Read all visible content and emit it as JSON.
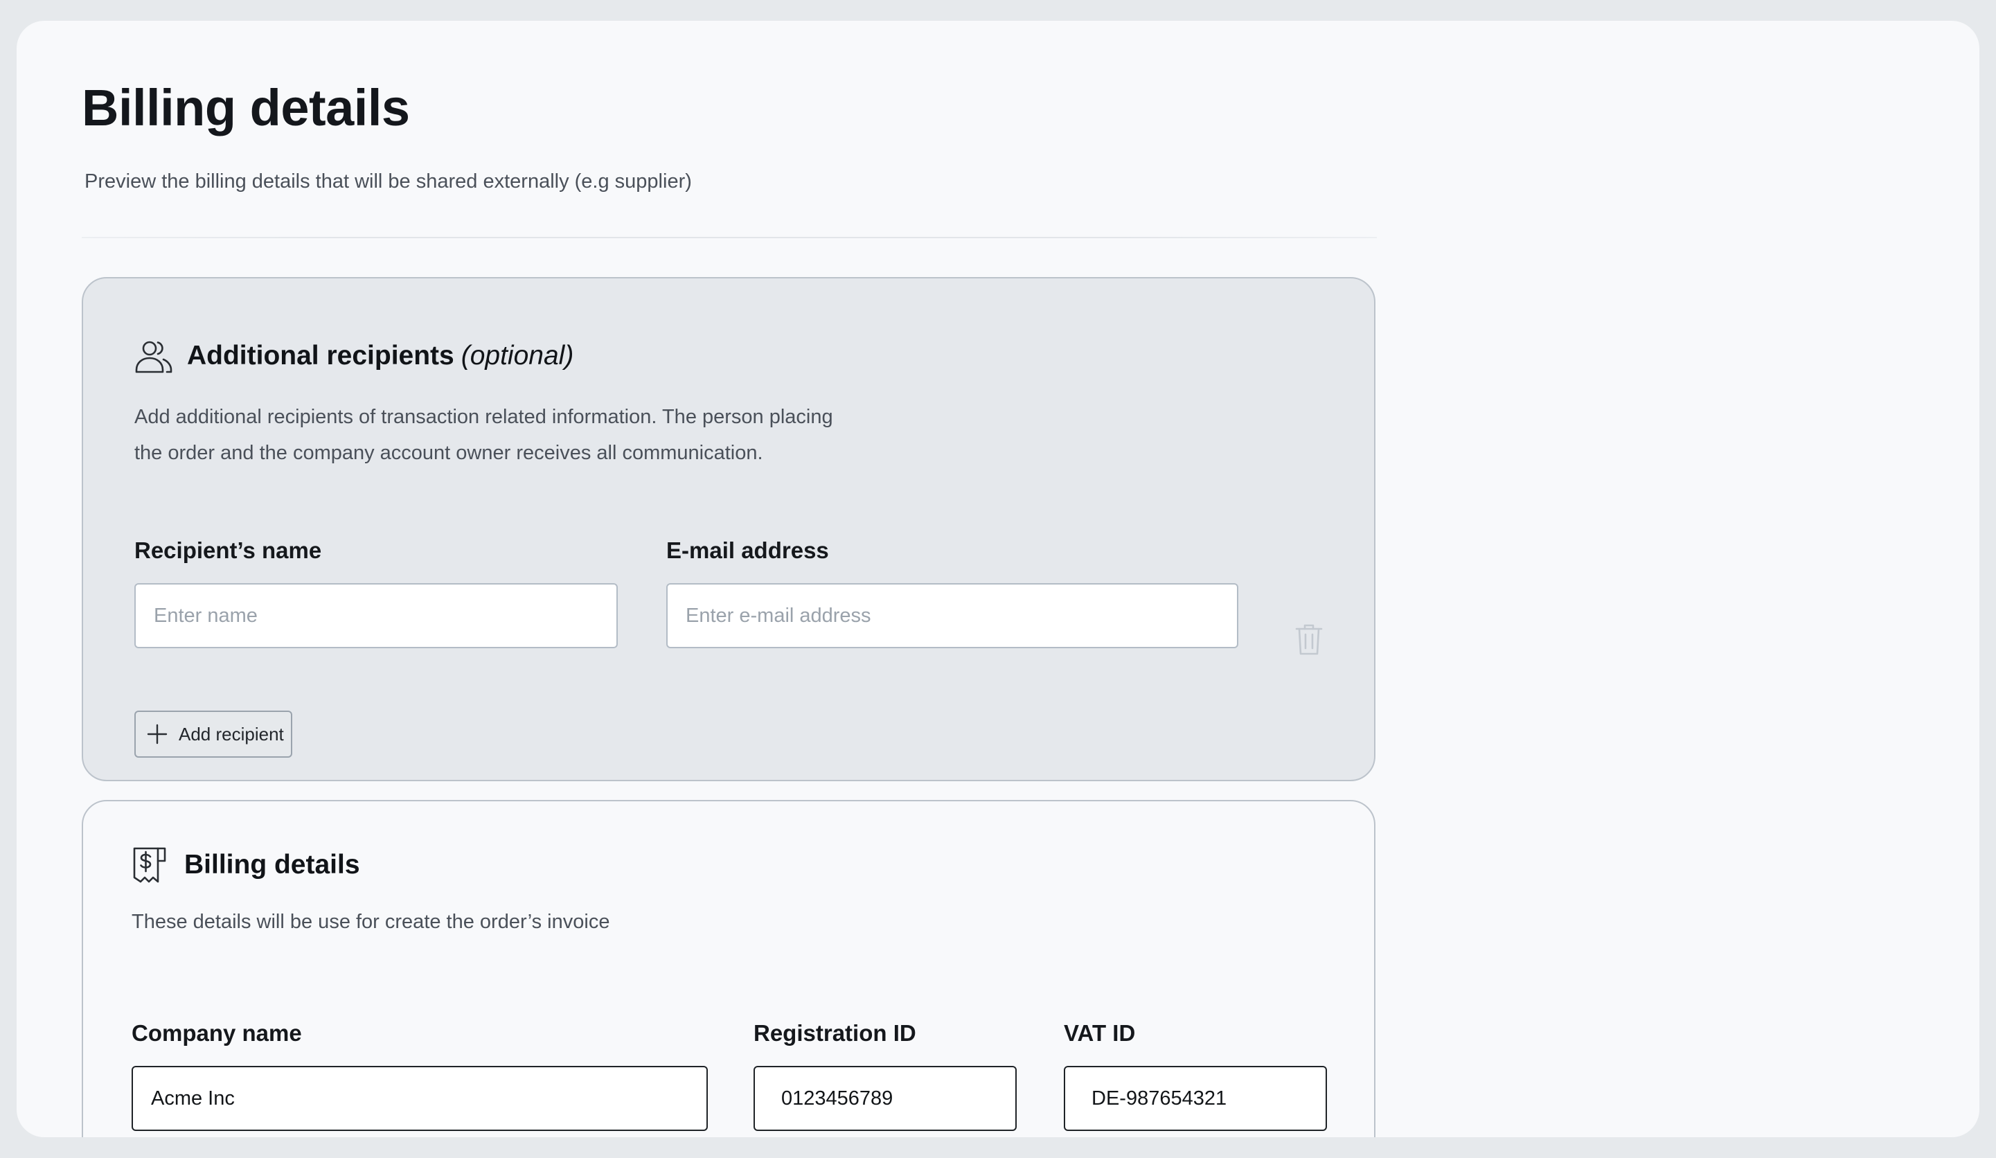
{
  "page": {
    "title": "Billing details",
    "subtitle": "Preview the billing details that will be shared externally (e.g supplier)"
  },
  "recipients": {
    "icon": "users-icon",
    "title": "Additional recipients",
    "title_optional": "(optional)",
    "description_line1": "Add additional recipients of transaction related information. The person placing",
    "description_line2": "the order and the company account owner receives all communication.",
    "name_label": "Recipient’s name",
    "name_placeholder": "Enter name",
    "name_value": "",
    "email_label": "E-mail address",
    "email_placeholder": "Enter e-mail address",
    "email_value": "",
    "delete_icon": "trash-icon",
    "add_button_label": "Add recipient",
    "add_button_icon": "plus-icon"
  },
  "billing": {
    "icon": "receipt-dollar-icon",
    "title": "Billing details",
    "description": "These details will be use for create the order’s invoice",
    "company_label": "Company name",
    "company_value": "Acme Inc",
    "registration_label": "Registration ID",
    "registration_value": "0123456789",
    "vat_label": "VAT ID",
    "vat_value": "DE-987654321"
  },
  "colors": {
    "page_bg": "#e6e9ec",
    "panel_bg": "#f8f9fb",
    "recipients_card_bg": "#e5e8ec",
    "card_border": "#bcc3cb",
    "text_primary": "#111418",
    "text_secondary": "#4a5059"
  }
}
